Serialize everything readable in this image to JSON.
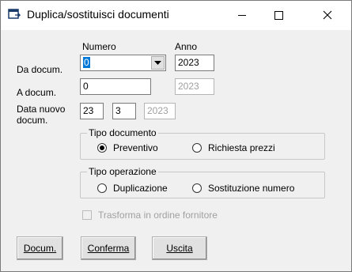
{
  "window": {
    "title": "Duplica/sostituisci documenti",
    "icon": "document-window-icon",
    "controls": [
      "minimize-icon",
      "maximize-icon",
      "close-icon"
    ]
  },
  "headers": {
    "numero": "Numero",
    "anno": "Anno"
  },
  "da_docum": {
    "label": "Da docum.",
    "numero": "0",
    "anno": "2023"
  },
  "a_docum": {
    "label": "A docum.",
    "numero": "0",
    "anno": "2023"
  },
  "data_nuovo": {
    "label_line1": "Data nuovo",
    "label_line2": "docum.",
    "giorno": "23",
    "mese": "3",
    "anno": "2023"
  },
  "tipo_documento": {
    "title": "Tipo documento",
    "options": [
      {
        "label": "Preventivo",
        "selected": true
      },
      {
        "label": "Richiesta prezzi",
        "selected": false
      }
    ]
  },
  "tipo_operazione": {
    "title": "Tipo operazione",
    "options": [
      {
        "label": "Duplicazione",
        "selected": false
      },
      {
        "label": "Sostituzione numero",
        "selected": false
      }
    ]
  },
  "trasforma": {
    "label": "Trasforma in ordine fornitore",
    "checked": false,
    "enabled": false
  },
  "buttons": {
    "docum": "Docum.",
    "conferma": "Conferma",
    "uscita": "Uscita"
  }
}
